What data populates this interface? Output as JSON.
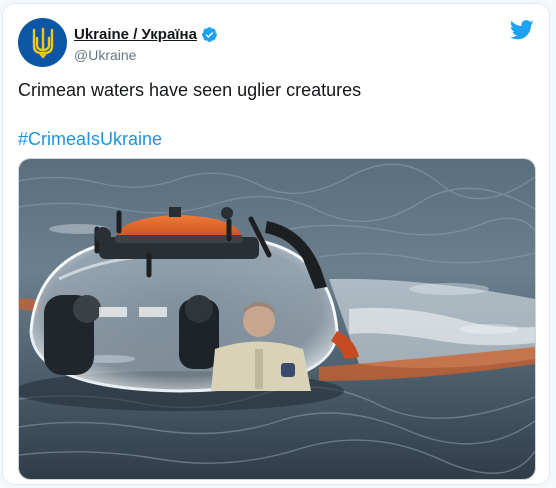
{
  "tweet": {
    "author": {
      "display_name": "Ukraine / Україна",
      "handle": "@Ukraine",
      "verified": true,
      "avatar_icon": "ukraine-trident-icon",
      "avatar_bg": "#0b57a4",
      "avatar_symbol_color": "#f5c518"
    },
    "text": "Crimean waters have seen uglier creatures",
    "hashtag": "#CrimeaIsUkraine",
    "media": {
      "kind": "photo"
    },
    "brand_icon": "twitter-bird-icon",
    "colors": {
      "link": "#1b95e0",
      "text": "#14171a",
      "secondary": "#657786",
      "verified": "#1da1f2",
      "brand": "#1da1f2"
    }
  }
}
